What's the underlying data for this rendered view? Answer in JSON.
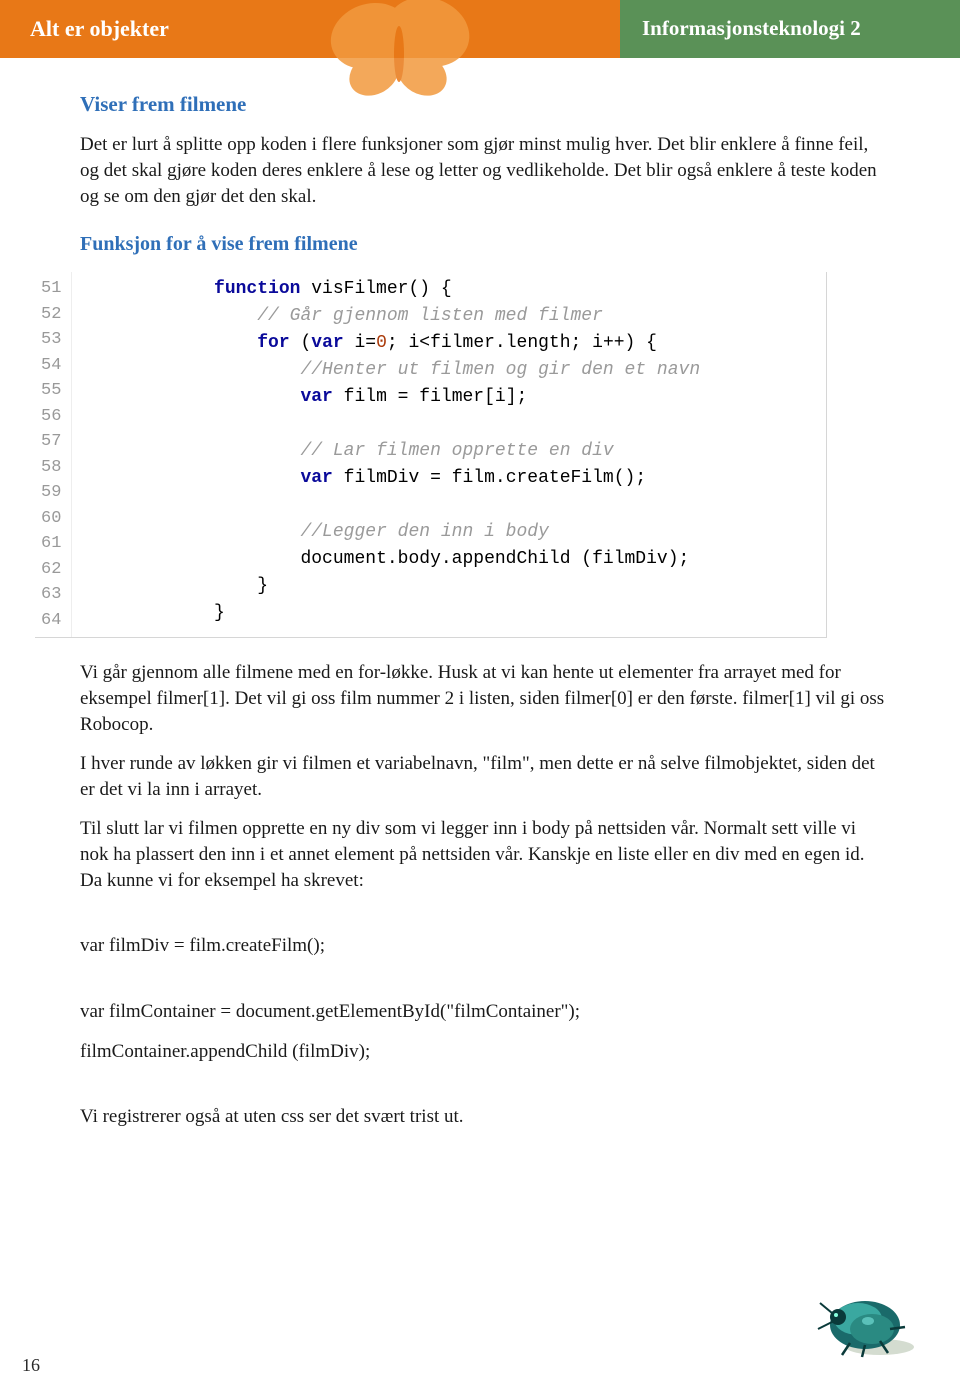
{
  "header": {
    "left": "Alt er objekter",
    "right": "Informasjonsteknologi 2"
  },
  "section_title": "Viser frem filmene",
  "para1": "Det er lurt å splitte opp koden i flere funksjoner som gjør minst mulig hver. Det blir enklere å finne feil, og det skal gjøre koden deres enklere å lese og letter og vedlikeholde. Det blir også enklere å teste koden og se om den gjør det den skal.",
  "sub_title": "Funksjon for å vise frem filmene",
  "code": {
    "line_start": 51,
    "line_end": 64,
    "rows": [
      {
        "indent": 3,
        "tokens": [
          {
            "t": "function ",
            "c": "kw"
          },
          {
            "t": "visFilmer() {",
            "c": "fn"
          }
        ]
      },
      {
        "indent": 4,
        "tokens": [
          {
            "t": "// Går gjennom listen med filmer",
            "c": "cmt"
          }
        ]
      },
      {
        "indent": 4,
        "tokens": [
          {
            "t": "for ",
            "c": "kw"
          },
          {
            "t": "(",
            "c": "pun"
          },
          {
            "t": "var ",
            "c": "kw"
          },
          {
            "t": "i=",
            "c": "fn"
          },
          {
            "t": "0",
            "c": "num"
          },
          {
            "t": "; i<filmer.length; i++) {",
            "c": "fn"
          }
        ]
      },
      {
        "indent": 5,
        "tokens": [
          {
            "t": "//Henter ut filmen og gir den et navn",
            "c": "cmt"
          }
        ]
      },
      {
        "indent": 5,
        "tokens": [
          {
            "t": "var ",
            "c": "kw"
          },
          {
            "t": "film = filmer[i];",
            "c": "fn"
          }
        ]
      },
      {
        "indent": 5,
        "tokens": []
      },
      {
        "indent": 5,
        "tokens": [
          {
            "t": "// Lar filmen opprette en div",
            "c": "cmt"
          }
        ]
      },
      {
        "indent": 5,
        "tokens": [
          {
            "t": "var ",
            "c": "kw"
          },
          {
            "t": "filmDiv = film.createFilm();",
            "c": "fn"
          }
        ]
      },
      {
        "indent": 5,
        "tokens": []
      },
      {
        "indent": 5,
        "tokens": [
          {
            "t": "//Legger den inn i body",
            "c": "cmt"
          }
        ]
      },
      {
        "indent": 5,
        "tokens": [
          {
            "t": "document.body.appendChild (filmDiv);",
            "c": "fn"
          }
        ]
      },
      {
        "indent": 4,
        "tokens": [
          {
            "t": "}",
            "c": "pun"
          }
        ]
      },
      {
        "indent": 3,
        "tokens": [
          {
            "t": "}",
            "c": "pun"
          }
        ]
      },
      {
        "indent": 0,
        "tokens": []
      }
    ]
  },
  "para2": "Vi går gjennom alle filmene med en for-løkke. Husk at vi kan hente ut elementer fra arrayet med for eksempel filmer[1]. Det vil gi oss film nummer 2 i listen, siden filmer[0] er den første. filmer[1] vil gi oss Robocop.",
  "para3": "I hver runde av løkken gir vi filmen et variabelnavn, \"film\", men dette er nå selve filmobjektet, siden det er det vi la inn i arrayet.",
  "para4": "Til slutt lar vi filmen opprette en ny div som vi legger inn i body på nettsiden vår. Normalt sett ville vi nok ha plassert den inn i et annet element på nettsiden vår. Kanskje en liste eller en div med en egen id. Da kunne vi for eksempel ha skrevet:",
  "code_inline1": "var filmDiv = film.createFilm();",
  "code_inline2": "var filmContainer = document.getElementById(\"filmContainer\");",
  "code_inline3": "filmContainer.appendChild (filmDiv);",
  "para5": "Vi registrerer også at uten css ser det svært trist ut.",
  "page_number": "16"
}
